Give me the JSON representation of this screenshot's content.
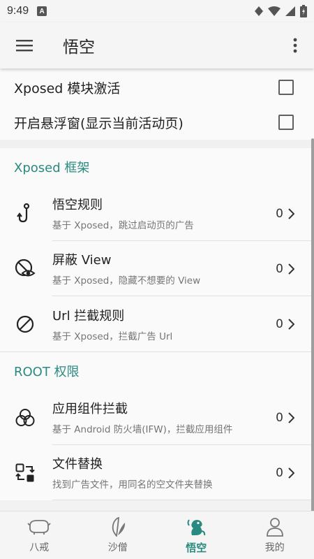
{
  "status_bar": {
    "time": "9:49",
    "notification_icon": "A"
  },
  "toolbar": {
    "title": "悟空",
    "menu_icon": "hamburger-menu-icon",
    "more_icon": "more-vertical-icon"
  },
  "checks": [
    {
      "label": "Xposed 模块激活",
      "checked": false
    },
    {
      "label": "开启悬浮窗(显示当前活动页)",
      "checked": false
    }
  ],
  "sections": [
    {
      "header": "Xposed 框架",
      "items": [
        {
          "title": "悟空规则",
          "subtitle": "基于 Xposed，跳过启动页的广告",
          "count": "0",
          "icon": "hook-icon"
        },
        {
          "title": "屏蔽 View",
          "subtitle": "基于 Xposed，隐藏不想要的 View",
          "count": "0",
          "icon": "eye-off-icon"
        },
        {
          "title": "Url 拦截规则",
          "subtitle": "基于 Xposed，拦截广告 Url",
          "count": "0",
          "icon": "block-icon"
        }
      ]
    },
    {
      "header": "ROOT 权限",
      "items": [
        {
          "title": "应用组件拦截",
          "subtitle": "基于 Android 防火墙(IFW)，拦截应用组件",
          "count": "0",
          "icon": "circles-icon"
        },
        {
          "title": "文件替换",
          "subtitle": "找到广告文件，用同名的空文件夹替换",
          "count": "0",
          "icon": "swap-icon"
        }
      ]
    }
  ],
  "bottom_nav": [
    {
      "label": "八戒",
      "icon": "pig-icon",
      "active": false
    },
    {
      "label": "沙僧",
      "icon": "leaf-icon",
      "active": false
    },
    {
      "label": "悟空",
      "icon": "monkey-icon",
      "active": true
    },
    {
      "label": "我的",
      "icon": "person-icon",
      "active": false
    }
  ],
  "colors": {
    "accent": "#2a8a80",
    "background": "#fafafa",
    "text_primary": "#212121",
    "text_secondary": "#757575"
  }
}
